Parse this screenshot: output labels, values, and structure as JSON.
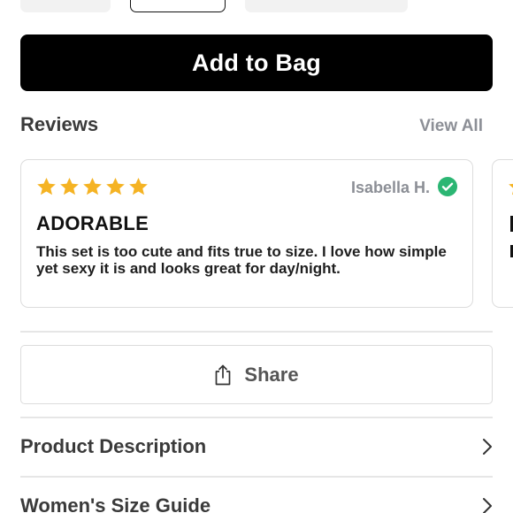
{
  "product": {
    "add_to_bag_label": "Add to Bag"
  },
  "reviews": {
    "title": "Reviews",
    "view_all_label": "View All",
    "items": [
      {
        "rating": 5,
        "reviewer": "Isabella H.",
        "verified": true,
        "title": "ADORABLE",
        "body": "This set is too cute and fits true to size. I love how simple yet sexy it is and looks great for day/night."
      }
    ]
  },
  "share": {
    "label": "Share",
    "icon": "share-icon"
  },
  "rows": [
    {
      "label": "Product Description",
      "icon": "chevron-right-icon"
    },
    {
      "label": "Women's Size Guide",
      "icon": "chevron-right-icon"
    }
  ],
  "colors": {
    "star": "#f5b323",
    "verified": "#2bb673",
    "primary_button": "#000000",
    "muted_text": "#8c8f96"
  }
}
